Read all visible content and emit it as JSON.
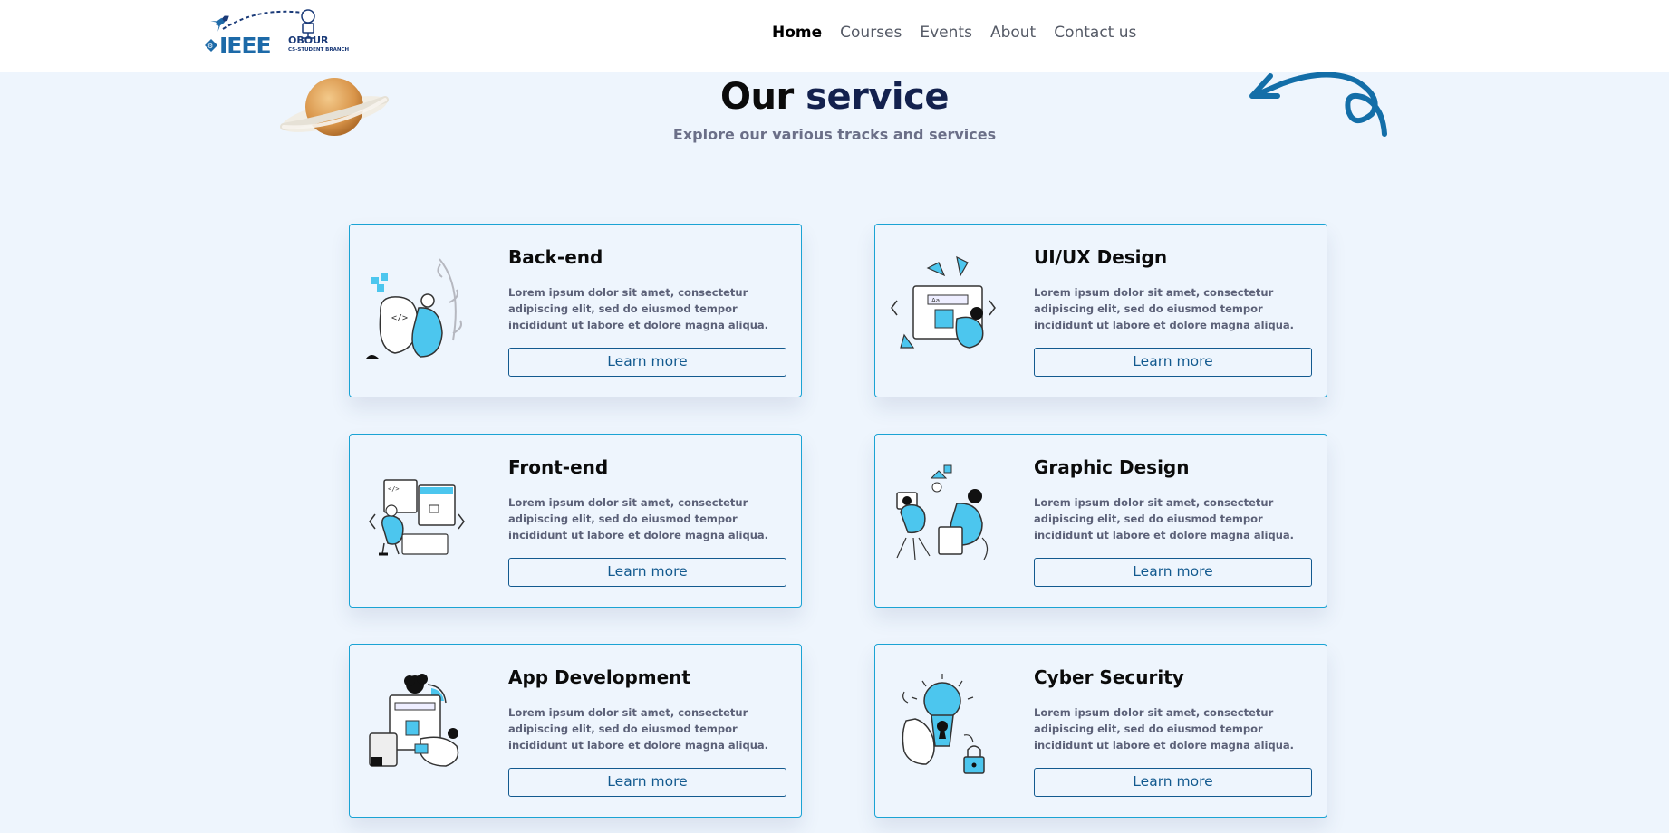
{
  "brand": {
    "name": "IEEE",
    "chapter": "OBOUR",
    "branch_label": "CS-STUDENT BRANCH"
  },
  "nav": {
    "items": [
      {
        "label": "Home",
        "active": true
      },
      {
        "label": "Courses",
        "active": false
      },
      {
        "label": "Events",
        "active": false
      },
      {
        "label": "About",
        "active": false
      },
      {
        "label": "Contact us",
        "active": false
      }
    ]
  },
  "hero": {
    "title_word1": "Our",
    "title_word2": "service",
    "subtitle": "Explore our various tracks and services"
  },
  "cards": [
    {
      "title": "Back-end",
      "description": "Lorem ipsum dolor sit amet, consectetur adipiscing elit, sed do eiusmod tempor incididunt ut labore et dolore magna aliqua.",
      "button": "Learn more",
      "icon": "backend-illustration"
    },
    {
      "title": "UI/UX Design",
      "description": "Lorem ipsum dolor sit amet, consectetur adipiscing elit, sed do eiusmod tempor incididunt ut labore et dolore magna aliqua.",
      "button": "Learn more",
      "icon": "uiux-illustration"
    },
    {
      "title": "Front-end",
      "description": "Lorem ipsum dolor sit amet, consectetur adipiscing elit, sed do eiusmod tempor incididunt ut labore et dolore magna aliqua.",
      "button": "Learn more",
      "icon": "frontend-illustration"
    },
    {
      "title": "Graphic Design",
      "description": "Lorem ipsum dolor sit amet, consectetur adipiscing elit, sed do eiusmod tempor incididunt ut labore et dolore magna aliqua.",
      "button": "Learn more",
      "icon": "graphic-design-illustration"
    },
    {
      "title": "App Development",
      "description": "Lorem ipsum dolor sit amet, consectetur adipiscing elit, sed do eiusmod tempor incididunt ut labore et dolore magna aliqua.",
      "button": "Learn more",
      "icon": "app-development-illustration"
    },
    {
      "title": "Cyber Security",
      "description": "Lorem ipsum dolor sit amet, consectetur adipiscing elit, sed do eiusmod tempor incididunt ut labore et dolore magna aliqua.",
      "button": "Learn more",
      "icon": "cyber-security-illustration"
    }
  ],
  "colors": {
    "page_bg": "#eef5fd",
    "accent_blue": "#1aa3d4",
    "button_blue": "#135a8f",
    "title_navy": "#13214e",
    "illustration_cyan": "#4cc6ee"
  }
}
